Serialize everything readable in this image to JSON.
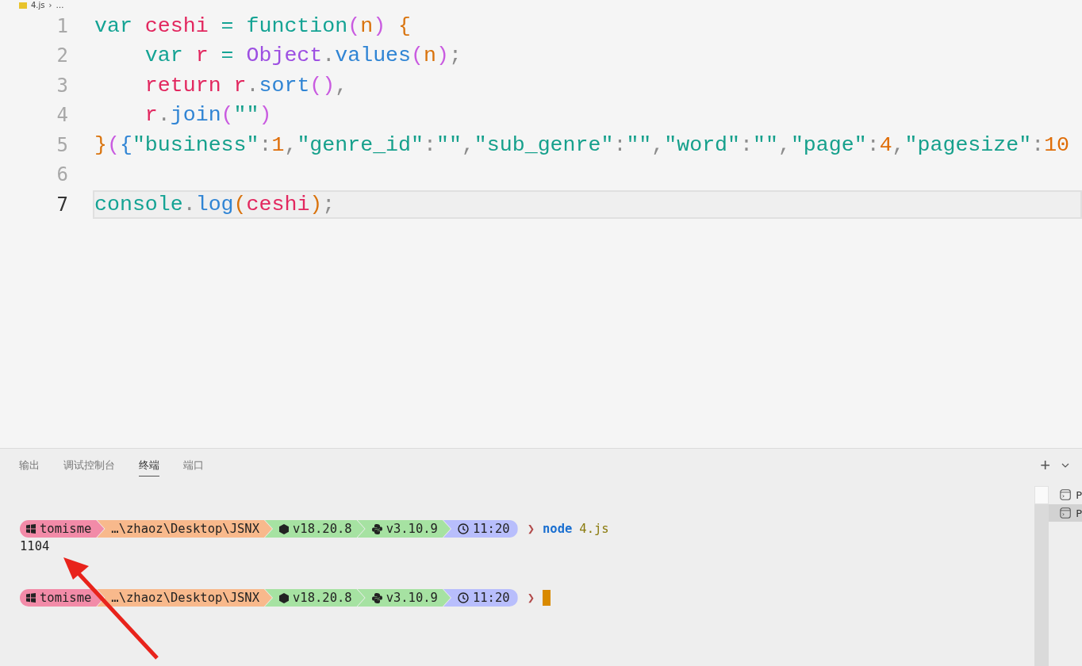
{
  "breadcrumb": {
    "file": "4.js",
    "separator": "›",
    "rest": "…"
  },
  "editor": {
    "lines": [
      {
        "number": "1",
        "selected": false,
        "tokens": [
          {
            "t": "var ",
            "color": "#14a394"
          },
          {
            "t": "ceshi ",
            "color": "#e2275f"
          },
          {
            "t": "= ",
            "color": "#14a394"
          },
          {
            "t": "function",
            "color": "#14a394"
          },
          {
            "t": "(",
            "color": "#c95be0"
          },
          {
            "t": "n",
            "color": "#d9730d"
          },
          {
            "t": ") ",
            "color": "#c95be0"
          },
          {
            "t": "{",
            "color": "#d9730d"
          }
        ]
      },
      {
        "number": "2",
        "selected": false,
        "tokens": [
          {
            "t": "    var ",
            "color": "#14a394"
          },
          {
            "t": "r ",
            "color": "#e2275f"
          },
          {
            "t": "= ",
            "color": "#14a394"
          },
          {
            "t": "Object",
            "color": "#9d4fe2"
          },
          {
            "t": ".",
            "color": "#8c8c8c"
          },
          {
            "t": "values",
            "color": "#2f84d4"
          },
          {
            "t": "(",
            "color": "#c95be0"
          },
          {
            "t": "n",
            "color": "#d9730d"
          },
          {
            "t": ")",
            "color": "#c95be0"
          },
          {
            "t": ";",
            "color": "#8c8c8c"
          }
        ]
      },
      {
        "number": "3",
        "selected": false,
        "tokens": [
          {
            "t": "    return ",
            "color": "#e2275f"
          },
          {
            "t": "r",
            "color": "#e2275f"
          },
          {
            "t": ".",
            "color": "#8c8c8c"
          },
          {
            "t": "sort",
            "color": "#2f84d4"
          },
          {
            "t": "()",
            "color": "#c95be0"
          },
          {
            "t": ",",
            "color": "#8c8c8c"
          }
        ]
      },
      {
        "number": "4",
        "selected": false,
        "tokens": [
          {
            "t": "    r",
            "color": "#e2275f"
          },
          {
            "t": ".",
            "color": "#8c8c8c"
          },
          {
            "t": "join",
            "color": "#2f84d4"
          },
          {
            "t": "(",
            "color": "#c95be0"
          },
          {
            "t": "\"\"",
            "color": "#16a08c"
          },
          {
            "t": ")",
            "color": "#c95be0"
          }
        ]
      },
      {
        "number": "5",
        "selected": false,
        "tokens": [
          {
            "t": "}",
            "color": "#d9730d"
          },
          {
            "t": "(",
            "color": "#c95be0"
          },
          {
            "t": "{",
            "color": "#2f84d4"
          },
          {
            "t": "\"business\"",
            "color": "#16a08c"
          },
          {
            "t": ":",
            "color": "#8c8c8c"
          },
          {
            "t": "1",
            "color": "#df6d08"
          },
          {
            "t": ",",
            "color": "#8c8c8c"
          },
          {
            "t": "\"genre_id\"",
            "color": "#16a08c"
          },
          {
            "t": ":",
            "color": "#8c8c8c"
          },
          {
            "t": "\"\"",
            "color": "#16a08c"
          },
          {
            "t": ",",
            "color": "#8c8c8c"
          },
          {
            "t": "\"sub_genre\"",
            "color": "#16a08c"
          },
          {
            "t": ":",
            "color": "#8c8c8c"
          },
          {
            "t": "\"\"",
            "color": "#16a08c"
          },
          {
            "t": ",",
            "color": "#8c8c8c"
          },
          {
            "t": "\"word\"",
            "color": "#16a08c"
          },
          {
            "t": ":",
            "color": "#8c8c8c"
          },
          {
            "t": "\"\"",
            "color": "#16a08c"
          },
          {
            "t": ",",
            "color": "#8c8c8c"
          },
          {
            "t": "\"page\"",
            "color": "#16a08c"
          },
          {
            "t": ":",
            "color": "#8c8c8c"
          },
          {
            "t": "4",
            "color": "#df6d08"
          },
          {
            "t": ",",
            "color": "#8c8c8c"
          },
          {
            "t": "\"pagesize\"",
            "color": "#16a08c"
          },
          {
            "t": ":",
            "color": "#8c8c8c"
          },
          {
            "t": "10",
            "color": "#df6d08"
          }
        ]
      },
      {
        "number": "6",
        "selected": false
      },
      {
        "number": "7",
        "selected": true,
        "tokens": [
          {
            "t": "console",
            "color": "#14a394"
          },
          {
            "t": ".",
            "color": "#8c8c8c"
          },
          {
            "t": "log",
            "color": "#2f84d4"
          },
          {
            "t": "(",
            "color": "#d9730d"
          },
          {
            "t": "ceshi",
            "color": "#e2275f"
          },
          {
            "t": ")",
            "color": "#d9730d"
          },
          {
            "t": ";",
            "color": "#8c8c8c"
          }
        ]
      }
    ]
  },
  "panel": {
    "tabs": [
      {
        "label": "输出",
        "selected": false
      },
      {
        "label": "调试控制台",
        "selected": false
      },
      {
        "label": "终端",
        "selected": true
      },
      {
        "label": "端口",
        "selected": false
      }
    ],
    "add_button": "+",
    "terminal": {
      "entries": [
        {
          "segments": [
            {
              "kind": "user",
              "text": "tomisme"
            },
            {
              "kind": "path",
              "text": "…\\zhaoz\\Desktop\\JSNX"
            },
            {
              "kind": "node",
              "text": "v18.20.8"
            },
            {
              "kind": "python",
              "text": "v3.10.9"
            },
            {
              "kind": "time",
              "text": "11:20"
            }
          ],
          "symbol": "❯",
          "program": "node",
          "argument": "4.js",
          "output": "1104",
          "cursor": false
        },
        {
          "segments": [
            {
              "kind": "user",
              "text": "tomisme"
            },
            {
              "kind": "path",
              "text": "…\\zhaoz\\Desktop\\JSNX"
            },
            {
              "kind": "node",
              "text": "v18.20.8"
            },
            {
              "kind": "python",
              "text": "v3.10.9"
            },
            {
              "kind": "time",
              "text": "11:20"
            }
          ],
          "symbol": "❯",
          "cursor": true
        }
      ]
    },
    "terminal_list": [
      {
        "label": "P",
        "selected": false
      },
      {
        "label": "P",
        "selected": true
      }
    ]
  }
}
